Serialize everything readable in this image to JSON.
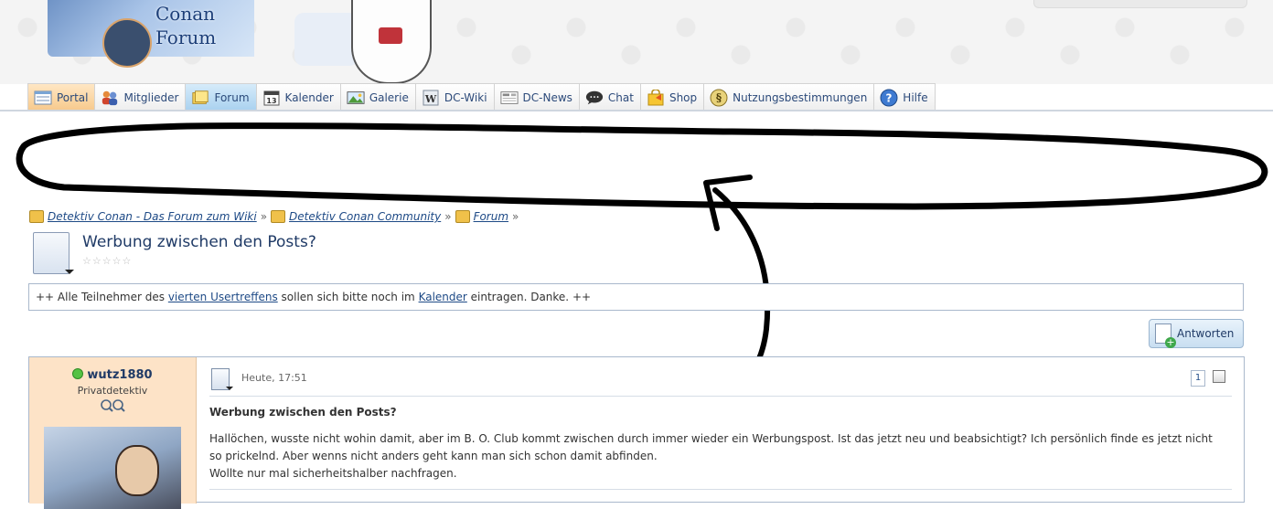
{
  "header": {
    "logo_line1": "Conan",
    "logo_line2": "Forum"
  },
  "nav": {
    "items": [
      {
        "label": "Portal",
        "icon": "portal-icon"
      },
      {
        "label": "Mitglieder",
        "icon": "members-icon"
      },
      {
        "label": "Forum",
        "icon": "forum-folder-icon"
      },
      {
        "label": "Kalender",
        "icon": "calendar-icon"
      },
      {
        "label": "Galerie",
        "icon": "gallery-icon"
      },
      {
        "label": "DC-Wiki",
        "icon": "wiki-icon"
      },
      {
        "label": "DC-News",
        "icon": "news-icon"
      },
      {
        "label": "Chat",
        "icon": "chat-bubble-icon"
      },
      {
        "label": "Shop",
        "icon": "shop-bag-icon"
      },
      {
        "label": "Nutzungsbestimmungen",
        "icon": "paragraph-icon"
      },
      {
        "label": "Hilfe",
        "icon": "help-icon"
      }
    ]
  },
  "breadcrumb": {
    "items": [
      "Detektiv Conan - Das Forum zum Wiki",
      "Detektiv Conan Community",
      "Forum"
    ],
    "separator": "»"
  },
  "thread": {
    "title": "Werbung zwischen den Posts?",
    "rating_stars": "☆☆☆☆☆"
  },
  "announcement": {
    "prefix": "++ Alle Teilnehmer des ",
    "link1": "vierten Usertreffens",
    "middle": " sollen sich bitte noch im ",
    "link2": "Kalender",
    "suffix": " eintragen. Danke. ++"
  },
  "reply_button": {
    "label": "Antworten"
  },
  "post": {
    "username": "wutz1880",
    "rank": "Privatdetektiv",
    "date": "Heute, 17:51",
    "number": "1",
    "title": "Werbung zwischen den Posts?",
    "body_line1": "Hallöchen, wusste nicht wohin damit, aber im B. O. Club kommt zwischen durch immer wieder ein Werbungspost. Ist das jetzt neu und beabsichtigt? Ich persönlich finde es jetzt nicht so prickelnd. Aber wenns nicht anders geht kann man sich schon damit abfinden.",
    "body_line2": "Wollte nur mal sicherheitshalber nachfragen."
  },
  "colors": {
    "link": "#1e4a86",
    "sidebar_bg": "#fde3c7",
    "active_tab": "#a9d1ef",
    "online": "#55c244"
  }
}
